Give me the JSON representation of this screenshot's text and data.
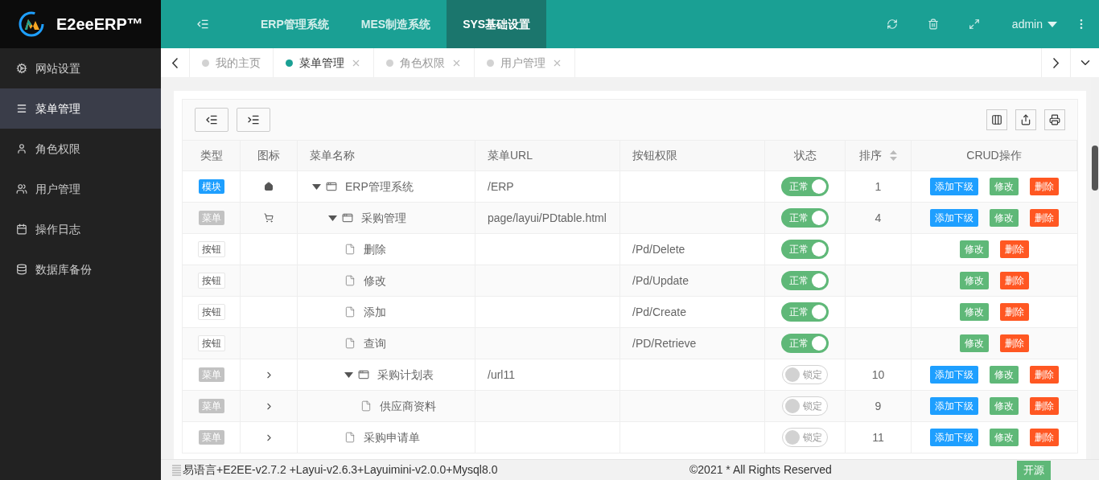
{
  "logo": {
    "title": "E2eeERP™"
  },
  "sidebar": {
    "items": [
      {
        "label": "网站设置",
        "selected": false
      },
      {
        "label": "菜单管理",
        "selected": true
      },
      {
        "label": "角色权限",
        "selected": false
      },
      {
        "label": "用户管理",
        "selected": false
      },
      {
        "label": "操作日志",
        "selected": false
      },
      {
        "label": "数据库备份",
        "selected": false
      }
    ]
  },
  "topbar": {
    "nav": [
      {
        "label": "ERP管理系统",
        "selected": false
      },
      {
        "label": "MES制造系统",
        "selected": false
      },
      {
        "label": "SYS基础设置",
        "selected": true
      }
    ],
    "user": "admin"
  },
  "tabs": [
    {
      "label": "我的主页",
      "selected": false,
      "closable": false
    },
    {
      "label": "菜单管理",
      "selected": true,
      "closable": true
    },
    {
      "label": "角色权限",
      "selected": false,
      "closable": true
    },
    {
      "label": "用户管理",
      "selected": false,
      "closable": true
    }
  ],
  "table": {
    "columns": [
      "类型",
      "图标",
      "菜单名称",
      "菜单URL",
      "按钮权限",
      "状态",
      "排序",
      "CRUD操作"
    ],
    "rows": [
      {
        "type": "模块",
        "kind": "module",
        "name": "ERP管理系统",
        "url": "/ERP",
        "on": true,
        "status": "正常",
        "order": "1",
        "expanded": true,
        "actions": [
          {
            "label": "添加下级",
            "kind": "add"
          },
          {
            "label": "修改",
            "kind": "edit"
          },
          {
            "label": "删除",
            "kind": "delete"
          }
        ],
        "children": [
          {
            "type": "菜单",
            "kind": "menu",
            "name": "采购管理",
            "url": "page/layui/PDtable.html",
            "on": true,
            "status": "正常",
            "order": "4",
            "expanded": true,
            "actions": [
              {
                "label": "添加下级",
                "kind": "add"
              },
              {
                "label": "修改",
                "kind": "edit"
              },
              {
                "label": "删除",
                "kind": "delete"
              }
            ],
            "children": [
              {
                "type": "按钮",
                "kind": "button",
                "name": "删除",
                "permission": "/Pd/Delete",
                "on": true,
                "status": "正常",
                "actions": [
                  {
                    "label": "修改",
                    "kind": "edit"
                  },
                  {
                    "label": "删除",
                    "kind": "delete"
                  }
                ]
              },
              {
                "type": "按钮",
                "kind": "button",
                "name": "修改",
                "permission": "/Pd/Update",
                "on": true,
                "status": "正常",
                "actions": [
                  {
                    "label": "修改",
                    "kind": "edit"
                  },
                  {
                    "label": "删除",
                    "kind": "delete"
                  }
                ]
              },
              {
                "type": "按钮",
                "kind": "button",
                "name": "添加",
                "permission": "/Pd/Create",
                "on": true,
                "status": "正常",
                "actions": [
                  {
                    "label": "修改",
                    "kind": "edit"
                  },
                  {
                    "label": "删除",
                    "kind": "delete"
                  }
                ]
              },
              {
                "type": "按钮",
                "kind": "button",
                "name": "查询",
                "permission": "/PD/Retrieve",
                "on": true,
                "status": "正常",
                "actions": [
                  {
                    "label": "修改",
                    "kind": "edit"
                  },
                  {
                    "label": "删除",
                    "kind": "delete"
                  }
                ]
              },
              {
                "type": "菜单",
                "kind": "menu",
                "name": "采购计划表",
                "url": "/url11",
                "on": false,
                "status": "锁定",
                "order": "10",
                "expanded": true,
                "actions": [
                  {
                    "label": "添加下级",
                    "kind": "add"
                  },
                  {
                    "label": "修改",
                    "kind": "edit"
                  },
                  {
                    "label": "删除",
                    "kind": "delete"
                  }
                ],
                "children": [
                  {
                    "type": "菜单",
                    "kind": "menu",
                    "name": "供应商资料",
                    "on": false,
                    "status": "锁定",
                    "order": "9",
                    "actions": [
                      {
                        "label": "添加下级",
                        "kind": "add"
                      },
                      {
                        "label": "修改",
                        "kind": "edit"
                      },
                      {
                        "label": "删除",
                        "kind": "delete"
                      }
                    ]
                  }
                ]
              },
              {
                "type": "菜单",
                "kind": "menu",
                "name": "采购申请单",
                "on": false,
                "status": "锁定",
                "order": "11",
                "actions": [
                  {
                    "label": "添加下级",
                    "kind": "add"
                  },
                  {
                    "label": "修改",
                    "kind": "edit"
                  },
                  {
                    "label": "删除",
                    "kind": "delete"
                  }
                ]
              }
            ]
          }
        ]
      }
    ]
  },
  "footer": {
    "version": "易语言+E2EE-v2.7.2 +Layui-v2.6.3+Layuimini-v2.0.0+Mysql8.0",
    "copyright": "©2021 * All Rights Reserved",
    "button": "开源"
  }
}
